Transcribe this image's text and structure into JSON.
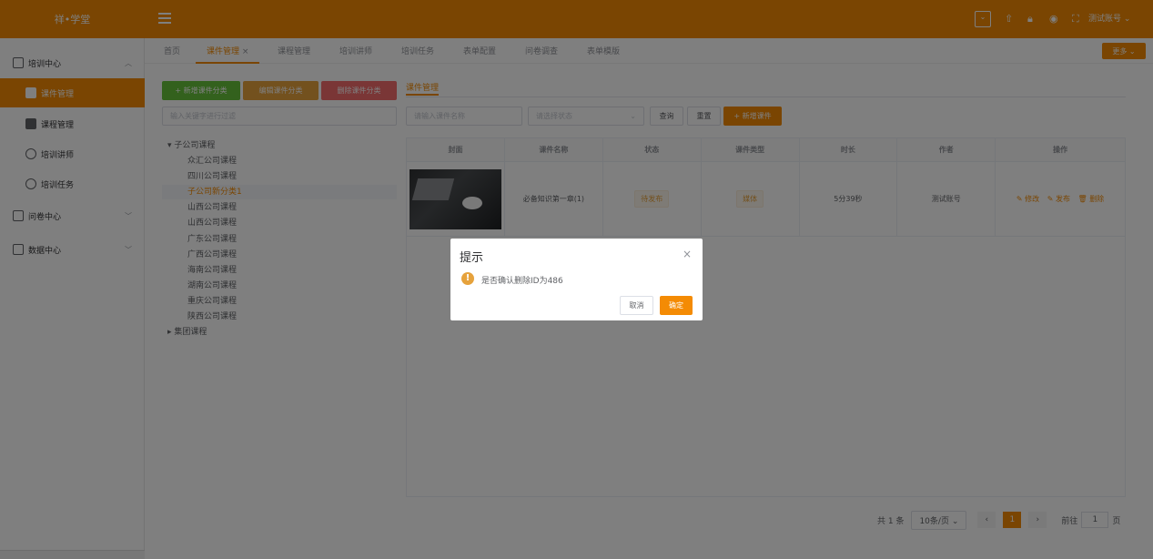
{
  "app": {
    "title": "祥•学堂",
    "user": "测试账号"
  },
  "sidebar": {
    "items": [
      {
        "label": "培训中心"
      },
      {
        "label": "课件管理"
      },
      {
        "label": "课程管理"
      },
      {
        "label": "培训讲师"
      },
      {
        "label": "培训任务"
      },
      {
        "label": "问卷中心"
      },
      {
        "label": "数据中心"
      }
    ]
  },
  "tabs": [
    {
      "label": "首页"
    },
    {
      "label": "课件管理"
    },
    {
      "label": "课程管理"
    },
    {
      "label": "培训讲师"
    },
    {
      "label": "培训任务"
    },
    {
      "label": "表单配置"
    },
    {
      "label": "问卷调查"
    },
    {
      "label": "表单模版"
    }
  ],
  "more_label": "更多",
  "left_panel": {
    "add_category": "+ 新增课件分类",
    "edit_category": "编辑课件分类",
    "delete_category": "删除课件分类",
    "filter_placeholder": "输入关键字进行过滤",
    "tree": {
      "root": "子公司课程",
      "children": [
        "众汇公司课程",
        "四川公司课程",
        "子公司新分类1",
        "山西公司课程",
        "山西公司课程",
        "广东公司课程",
        "广西公司课程",
        "海南公司课程",
        "湖南公司课程",
        "重庆公司课程",
        "陕西公司课程"
      ],
      "root2": "集团课程"
    }
  },
  "main": {
    "panel_title": "课件管理",
    "name_placeholder": "请输入课件名称",
    "status_placeholder": "请选择状态",
    "query": "查询",
    "reset": "重置",
    "add_course": "+ 新增课件",
    "columns": [
      "封面",
      "课件名称",
      "状态",
      "课件类型",
      "时长",
      "作者",
      "操作"
    ],
    "rows": [
      {
        "name": "必备知识第一章(1)",
        "status": "待发布",
        "type": "媒体",
        "duration": "5分39秒",
        "author": "测试账号",
        "ops": [
          "修改",
          "发布",
          "删除"
        ]
      }
    ]
  },
  "pager": {
    "total": "共 1 条",
    "page_size": "10条/页",
    "current": "1",
    "goto_label": "前往",
    "goto_value": "1",
    "page_unit": "页"
  },
  "dialog": {
    "title": "提示",
    "message": "是否确认删除ID为486",
    "cancel": "取消",
    "confirm": "确定"
  },
  "colors": {
    "brand": "#f48b04",
    "success": "#67c23a",
    "danger": "#f56c6c",
    "warning": "#e6a23c"
  }
}
